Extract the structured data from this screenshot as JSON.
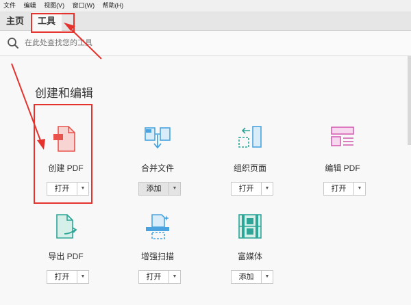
{
  "menu": [
    "文件",
    "编辑",
    "视图(V)",
    "窗口(W)",
    "帮助(H)"
  ],
  "tabs": {
    "home": "主页",
    "tools": "工具"
  },
  "search": {
    "placeholder": "在此处查找您的工具"
  },
  "section": {
    "title": "创建和编辑"
  },
  "tools": [
    {
      "label": "创建 PDF",
      "button": "打开",
      "icon": "create-pdf-icon"
    },
    {
      "label": "合并文件",
      "button": "添加",
      "icon": "combine-files-icon"
    },
    {
      "label": "组织页面",
      "button": "打开",
      "icon": "organize-pages-icon"
    },
    {
      "label": "编辑 PDF",
      "button": "打开",
      "icon": "edit-pdf-icon"
    },
    {
      "label": "导出 PDF",
      "button": "打开",
      "icon": "export-pdf-icon"
    },
    {
      "label": "增强扫描",
      "button": "打开",
      "icon": "enhance-scan-icon"
    },
    {
      "label": "富媒体",
      "button": "添加",
      "icon": "rich-media-icon"
    }
  ],
  "colors": {
    "highlight": "#e5322d",
    "pdf_red": "#e8534d",
    "blue": "#4aa3df",
    "pink": "#d45fb2",
    "teal": "#2ea597"
  }
}
